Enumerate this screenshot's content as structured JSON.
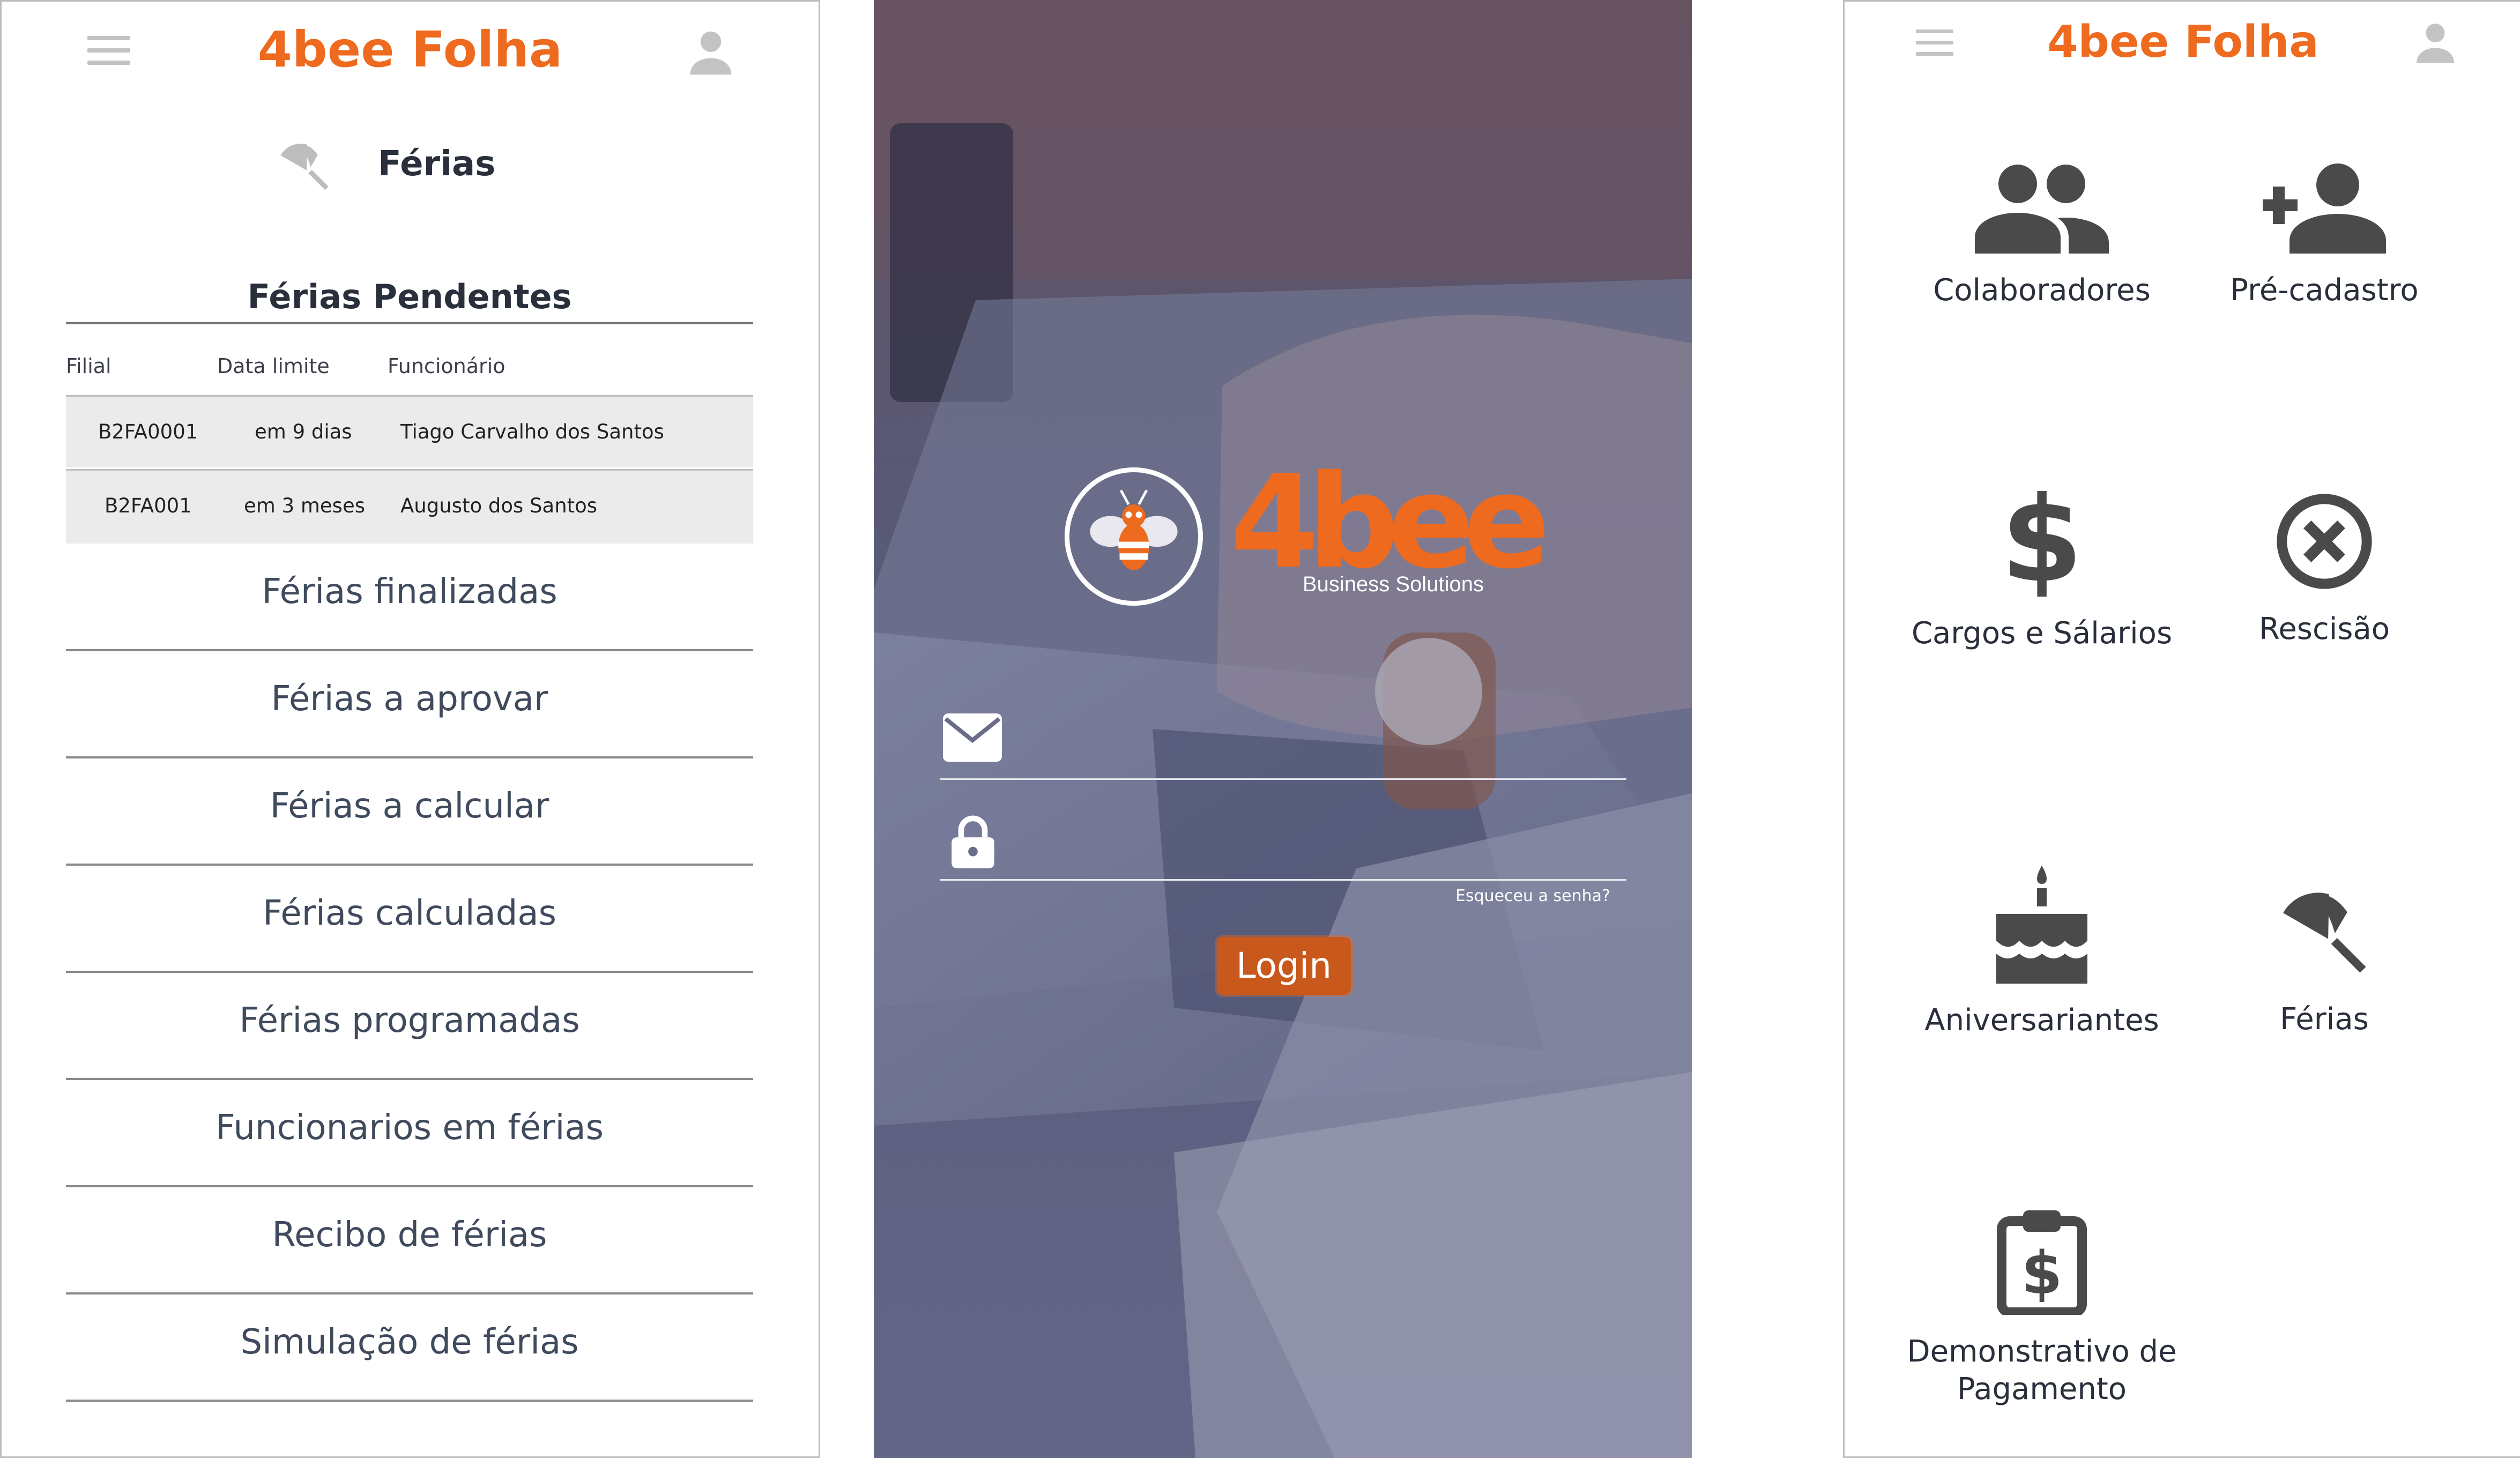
{
  "app": {
    "brand": "4bee Folha"
  },
  "ferias_screen": {
    "title": "Férias",
    "pendentes": {
      "title": "Férias Pendentes",
      "columns": [
        "Filial",
        "Data limite",
        "Funcionário"
      ],
      "rows": [
        {
          "filial": "B2FA0001",
          "data_limite": "em 9 dias",
          "funcionario": "Tiago Carvalho dos Santos"
        },
        {
          "filial": "B2FA001",
          "data_limite": "em 3 meses",
          "funcionario": "Augusto dos Santos"
        }
      ]
    },
    "menu": [
      "Férias finalizadas",
      "Férias a aprovar",
      "Férias a calcular",
      "Férias calculadas",
      "Férias programadas",
      "Funcionarios em férias",
      "Recibo de férias",
      "Simulação de férias"
    ]
  },
  "login_screen": {
    "logo_text": "4bee",
    "logo_subtitle": "Business Solutions",
    "forgot_password": "Esqueceu a senha?",
    "login_button": "Login"
  },
  "home_screen": {
    "tiles": [
      {
        "label": "Colaboradores",
        "icon": "people-icon"
      },
      {
        "label": "Pré-cadastro",
        "icon": "add-person-icon"
      },
      {
        "label": "Cargos e Sálarios",
        "icon": "dollar-icon"
      },
      {
        "label": "Rescisão",
        "icon": "cancel-circle-icon"
      },
      {
        "label": "Aniversariantes",
        "icon": "cake-icon"
      },
      {
        "label": "Férias",
        "icon": "umbrella-icon"
      },
      {
        "label": "Demonstrativo de Pagamento",
        "icon": "clipboard-dollar-icon"
      }
    ]
  },
  "colors": {
    "accent": "#ee6a1f",
    "icon_gray": "#4a4a4a",
    "row_bg": "#ebebeb"
  }
}
